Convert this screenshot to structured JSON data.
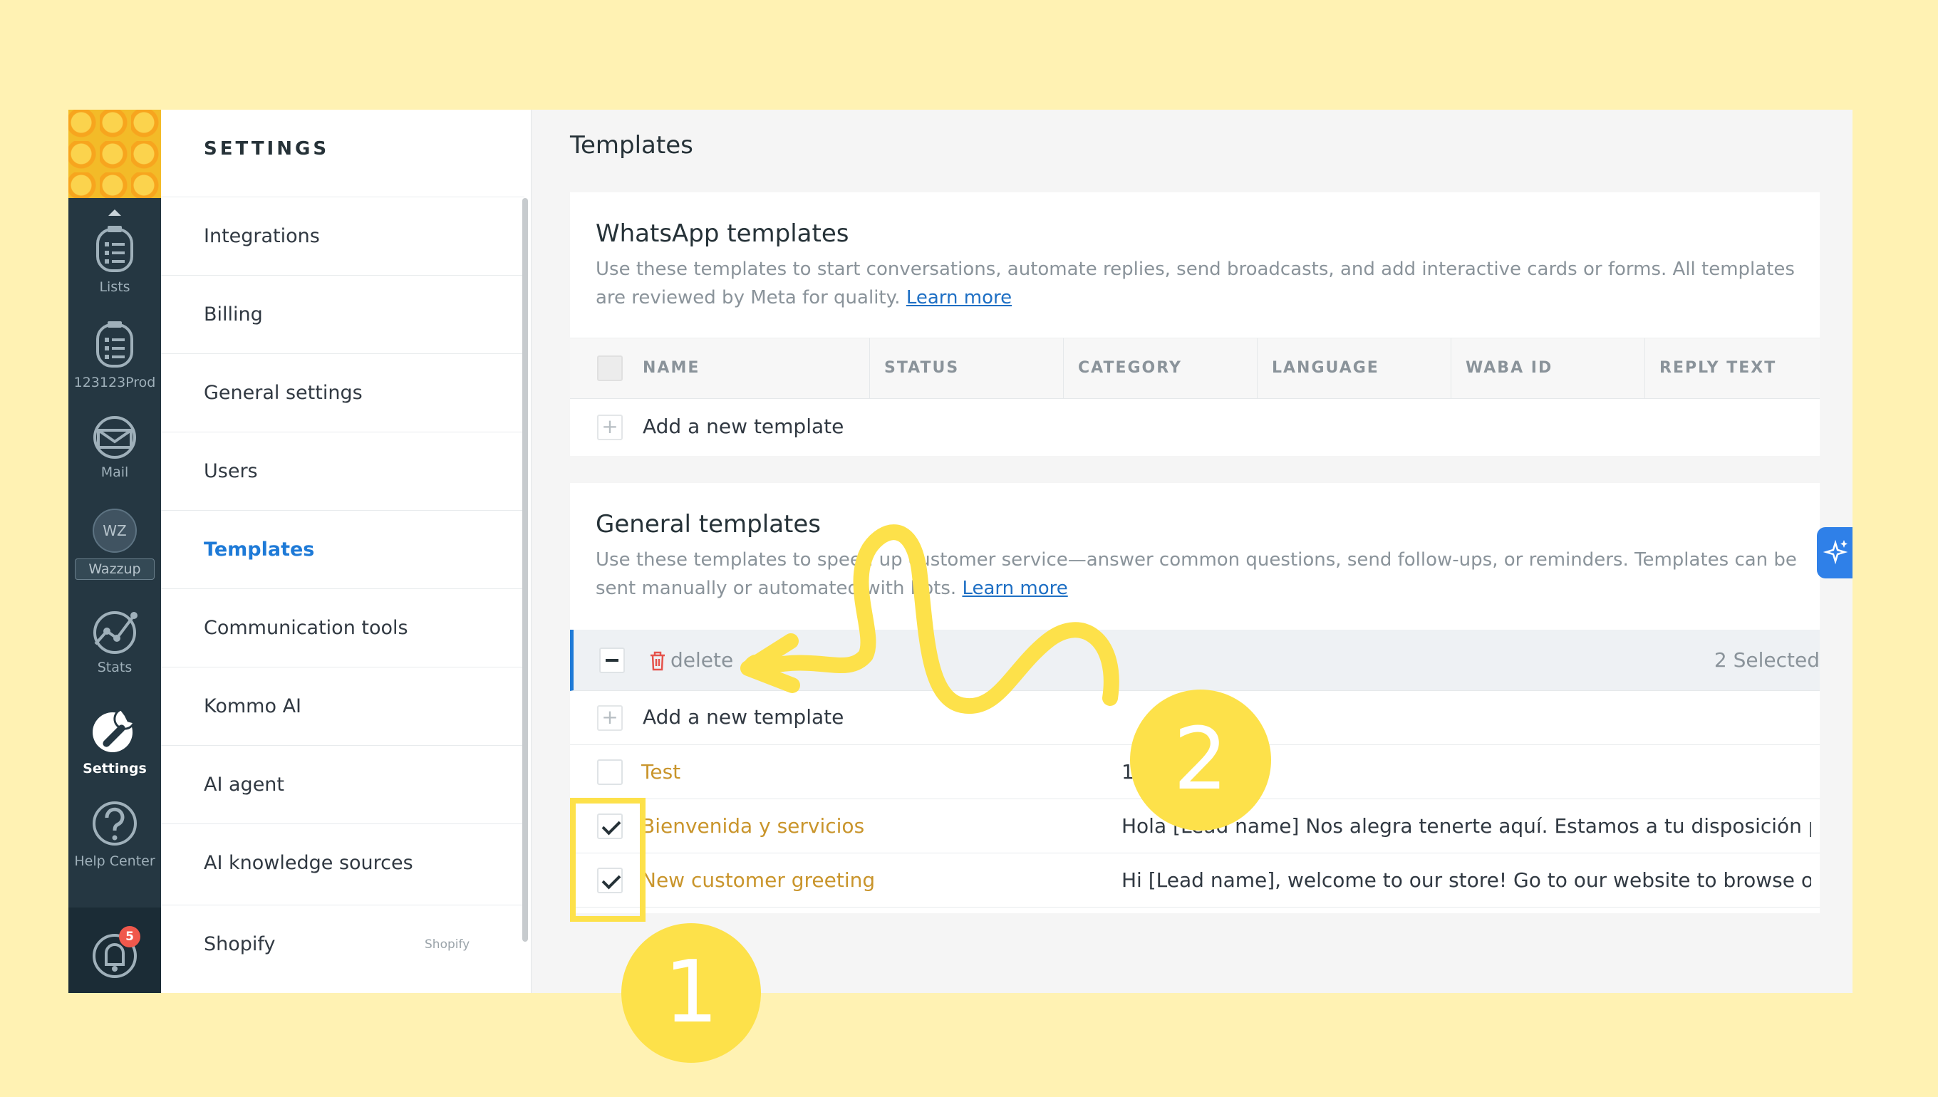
{
  "rail": {
    "items": [
      {
        "label": "Lists",
        "icon": "list-icon"
      },
      {
        "label": "123123Prod",
        "icon": "list-icon"
      },
      {
        "label": "Mail",
        "icon": "mail-icon"
      },
      {
        "label": "Wazzup",
        "icon": "wazzup-icon",
        "badge_text": "WZ"
      },
      {
        "label": "Stats",
        "icon": "stats-icon"
      },
      {
        "label": "Settings",
        "icon": "wrench-icon"
      },
      {
        "label": "Help Center",
        "icon": "help-icon"
      }
    ],
    "notifications_count": "5"
  },
  "menu": {
    "title": "SETTINGS",
    "items": [
      {
        "label": "Integrations"
      },
      {
        "label": "Billing"
      },
      {
        "label": "General settings"
      },
      {
        "label": "Users"
      },
      {
        "label": "Templates"
      },
      {
        "label": "Communication tools"
      },
      {
        "label": "Kommo AI"
      },
      {
        "label": "AI agent"
      },
      {
        "label": "AI knowledge sources"
      },
      {
        "label": "Shopify",
        "tag": "Shopify"
      }
    ]
  },
  "main": {
    "title": "Templates",
    "whatsapp": {
      "title": "WhatsApp templates",
      "desc": "Use these templates to start conversations, automate replies, send broadcasts, and add interactive cards or forms. All templates are reviewed by Meta for quality.",
      "learn_more": "Learn more",
      "columns": [
        "NAME",
        "STATUS",
        "CATEGORY",
        "LANGUAGE",
        "WABA ID",
        "REPLY TEXT"
      ],
      "add_label": "Add a new template"
    },
    "general": {
      "title": "General templates",
      "desc": "Use these templates to speed up customer service—answer common questions, send follow-ups, or reminders. Templates can be sent manually or automated with bots.",
      "learn_more": "Learn more",
      "delete_label": "delete",
      "selected_label": "2 Selected",
      "add_label": "Add a new template",
      "rows": [
        {
          "name": "Test",
          "reply": "1",
          "checked": false
        },
        {
          "name": "Bienvenida y servicios",
          "reply": "Hola [Lead name] Nos alegra tenerte aquí. Estamos a tu disposición para ayudarte",
          "checked": true
        },
        {
          "name": "New customer greeting",
          "reply": "Hi [Lead name], welcome to our store! Go to our website to browse our selection",
          "checked": true
        }
      ]
    }
  },
  "tutorial": {
    "step1": "1",
    "step2": "2"
  },
  "colors": {
    "accent": "#1e7ad7",
    "highlight": "#fde14a",
    "template_name": "#c9952c",
    "background": "#fff2b3"
  }
}
